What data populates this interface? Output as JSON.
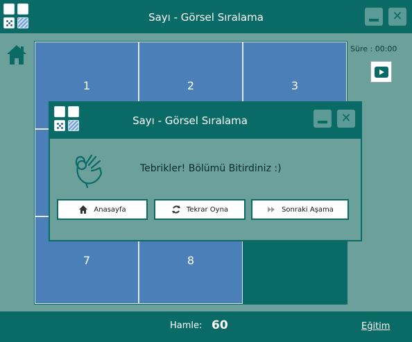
{
  "window": {
    "title": "Sayı - Görsel Sıralama",
    "minimize_icon": "minimize-icon",
    "close_icon": "close-icon"
  },
  "sidebar": {
    "home_icon": "home-icon",
    "timer_label": "Süre : 00:00",
    "video_icon": "video-play-icon"
  },
  "grid": {
    "tiles": [
      "1",
      "2",
      "3",
      "7",
      "8"
    ]
  },
  "dialog": {
    "title": "Sayı - Görsel Sıralama",
    "message": "Tebrikler! Bölümü Bitirdiniz :)",
    "buttons": {
      "home": "Anasayfa",
      "replay": "Tekrar Oyna",
      "next": "Sonraki Aşama"
    }
  },
  "footer": {
    "moves_label": "Hamle:",
    "moves_value": "60",
    "training_link": "Eğitim"
  },
  "colors": {
    "primary": "#0a6a66",
    "panel": "#6ba09b",
    "tile": "#4a80b7"
  }
}
